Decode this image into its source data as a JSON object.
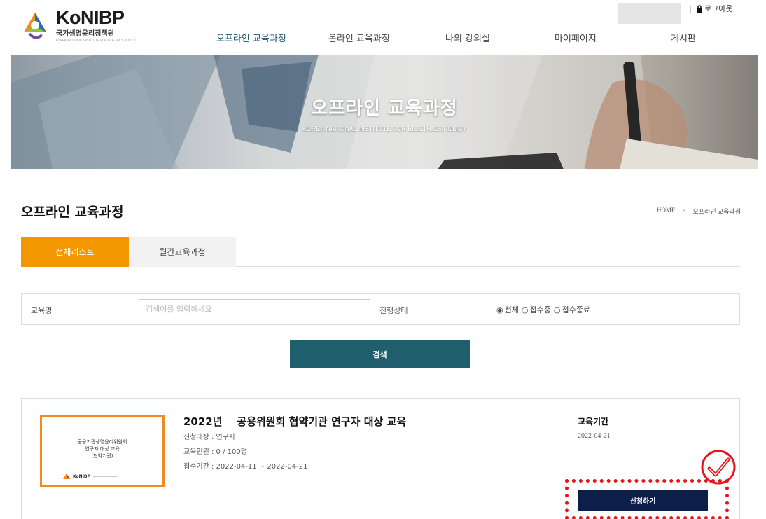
{
  "header": {
    "logo": {
      "title": "KoNIBP",
      "subtitle": "국가생명윤리정책원",
      "subtitle_en": "KOREA NATIONAL INSTITUTE FOR BIOETHICS POLICY"
    },
    "logout_label": "로그아웃",
    "nav": [
      {
        "label": "오프라인 교육과정"
      },
      {
        "label": "온라인 교육과정"
      },
      {
        "label": "나의 강의실"
      },
      {
        "label": "마이페이지"
      },
      {
        "label": "게시판"
      }
    ]
  },
  "hero": {
    "title": "오프라인 교육과정",
    "subtitle": "KOREA NATIONAL INSTITUTE FOR BIOETHICS POLICY"
  },
  "page": {
    "title": "오프라인 교육과정",
    "breadcrumb": {
      "home": "HOME",
      "separator": ">",
      "current": "오프라인 교육과정"
    }
  },
  "tabs": [
    {
      "label": "전체리스트",
      "active": true
    },
    {
      "label": "월간교육과정",
      "active": false
    }
  ],
  "search": {
    "name_label": "교육명",
    "placeholder": "검색어를 입력하세요",
    "status_label": "진행상태",
    "status_options": [
      {
        "label": "전체",
        "mark": "◉"
      },
      {
        "label": "접수중",
        "mark": "○"
      },
      {
        "label": "접수종료",
        "mark": "○"
      }
    ],
    "button_label": "검색"
  },
  "course": {
    "thumb_text": [
      "공용기관생명윤리위원회",
      "연구자 대상 교육",
      "(협약기관)"
    ],
    "thumb_logo": "KoNIBP",
    "title": "2022년    공용위원회 협약기관 연구자 대상 교육",
    "target": "신청대상 : 연구자",
    "capacity": "교육인원 : 0 / 100명",
    "reception": "접수기간 : 2022-04-11 ~ 2022-04-21",
    "period_label": "교육기간",
    "period": "2022-04-21",
    "apply_label": "신청하기"
  },
  "colors": {
    "accent_orange": "#f39800",
    "search_teal": "#1f5e6c",
    "apply_navy": "#0c1f4a",
    "active_nav": "#1a5670",
    "highlight_red": "#e8141c"
  }
}
